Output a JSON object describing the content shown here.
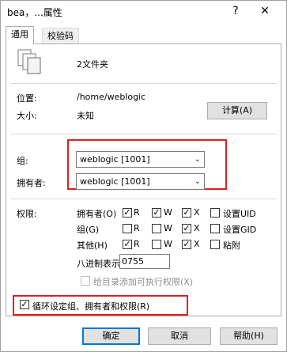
{
  "window": {
    "title": "bea，...属性",
    "help": "?",
    "close": "✕"
  },
  "tabs": [
    {
      "label": "通用"
    },
    {
      "label": "校验码"
    }
  ],
  "summary": {
    "text": "2文件夹",
    "icon": "files-icon"
  },
  "info": {
    "location_label": "位置:",
    "location_value": "/home/weblogic",
    "size_label": "大小:",
    "size_value": "未知",
    "compute_button": "计算(A)"
  },
  "ownership": {
    "group_label": "组:",
    "group_value": "weblogic [1001]",
    "owner_label": "拥有者:",
    "owner_value": "weblogic [1001]"
  },
  "permissions": {
    "label": "权限:",
    "rows": [
      {
        "name": "拥有者(O)",
        "r": true,
        "w": true,
        "x": true,
        "extra_label": "设置UID",
        "extra": false
      },
      {
        "name": "组(G)",
        "r": false,
        "w": false,
        "x": true,
        "extra_label": "设置GID",
        "extra": false
      },
      {
        "name": "其他(H)",
        "r": true,
        "w": false,
        "x": true,
        "extra_label": "粘附",
        "extra": false
      }
    ],
    "r_label": "R",
    "w_label": "W",
    "x_label": "X",
    "octal_label": "八进制表示:",
    "octal_value": "0755",
    "add_exec_label": "给目录添加可执行权限(X)",
    "add_exec_checked": false
  },
  "recursive": {
    "label": "循环设定组、拥有者和权限(R)",
    "checked": true
  },
  "buttons": {
    "ok": "确定",
    "cancel": "取消",
    "help": "帮助(H)"
  },
  "colors": {
    "highlight": "#e02020",
    "default_button": "#0078d7"
  }
}
